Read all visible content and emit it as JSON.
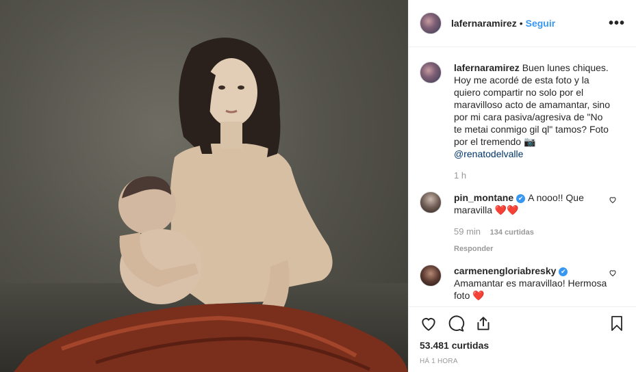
{
  "post": {
    "username": "lafernaramirez",
    "separator": "•",
    "follow_label": "Seguir",
    "more_label": "•••"
  },
  "caption": {
    "username": "lafernaramirez",
    "text": "Buen lunes chiques. Hoy me acordé de esta foto y la quiero compartir no solo por el maravilloso acto de amamantar, sino por mi cara pasiva/agresiva de \"No te metai conmigo gil ql\" tamos? Foto por el tremendo 📷",
    "mention": "@renatodelvalle",
    "time": "1 h"
  },
  "comments": [
    {
      "username": "pin_montane",
      "verified_mark": "✔",
      "text": "A nooo!! Que maravilla",
      "hearts": "❤️❤️",
      "time": "59 min",
      "likes": "134 curtidas",
      "reply": "Responder"
    },
    {
      "username": "carmenengloriabresky",
      "verified_mark": "✔",
      "text": "Amamantar es maravillao! Hermosa foto",
      "hearts": "❤️"
    }
  ],
  "footer": {
    "likes": "53.481 curtidas",
    "timestamp": "HÁ 1 HORA"
  },
  "icons": [
    "heart-icon",
    "comment-icon",
    "share-icon",
    "bookmark-icon",
    "more-icon"
  ],
  "colors": {
    "link": "#3897f0",
    "mention": "#003569",
    "muted": "#999999"
  }
}
